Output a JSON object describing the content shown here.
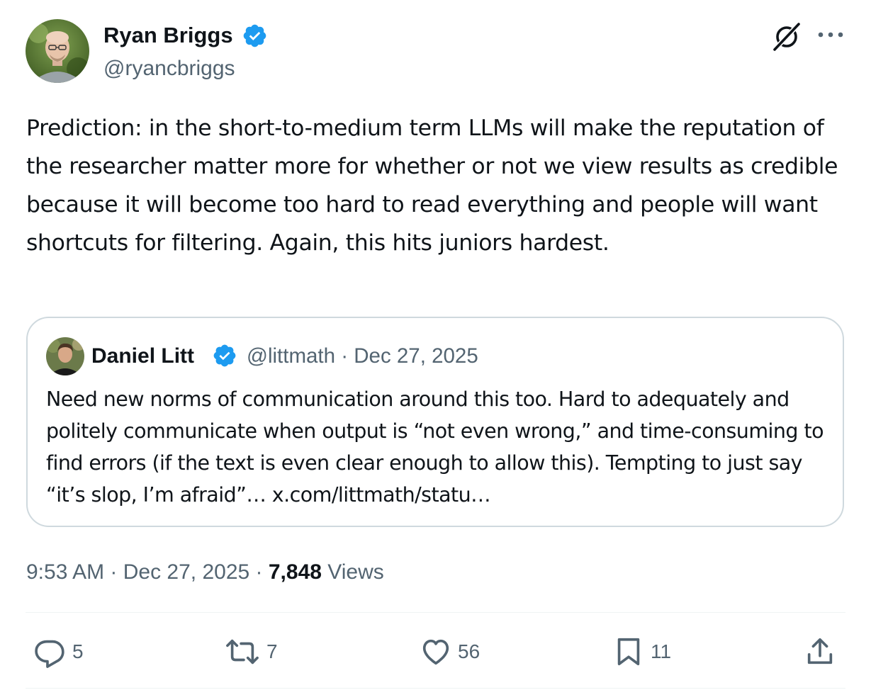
{
  "author": {
    "display_name": "Ryan Briggs",
    "handle": "@ryancbriggs",
    "verified": true
  },
  "tweet_text": "Prediction: in the short-to-medium term LLMs will make the reputation of the researcher matter more for whether or not we view results as credible because it will become too hard to read everything and people will want shortcuts for filtering. Again, this hits juniors hardest.",
  "quote": {
    "display_name": "Daniel Litt",
    "meta": "@littmath · Dec 27, 2025",
    "text": "Need new norms of communication around this too. Hard to adequately and politely communicate when output is “not even wrong,” and time-consuming to find errors (if the text is even clear enough to allow this). Tempting to just say “it’s slop, I’m afraid”… x.com/littmath/statu…"
  },
  "timestamp": "9:53 AM · Dec 27, 2025 · ",
  "views": {
    "count": "7,848",
    "label": " Views"
  },
  "actions": {
    "replies": "5",
    "reposts": "7",
    "likes": "56",
    "bookmarks": "11"
  },
  "colors": {
    "text_primary": "#0f1419",
    "text_secondary": "#536471",
    "verified_blue": "#1d9bf0",
    "border": "#cfd9de"
  },
  "icons": [
    "verified-badge-icon",
    "grok-icon",
    "more-icon",
    "reply-icon",
    "repost-icon",
    "like-icon",
    "bookmark-icon",
    "share-icon"
  ]
}
